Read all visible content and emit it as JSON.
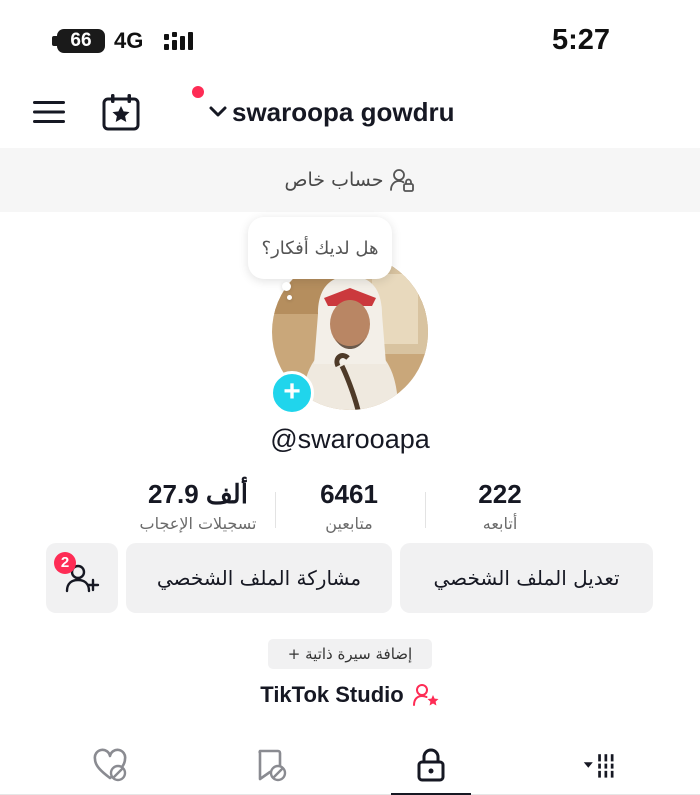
{
  "status_bar": {
    "battery": "66",
    "network": "4G",
    "time": "5:27"
  },
  "header": {
    "username": "swaroopa gowdru",
    "menu_icon": "hamburger-menu-icon",
    "calendar_icon": "calendar-star-icon",
    "switch_icon": "chevron-down-icon"
  },
  "private_banner": {
    "label": "حساب خاص",
    "icon": "private-account-icon"
  },
  "profile": {
    "bubble_text": "هل لديك أفكار؟",
    "handle": "@swarooapa"
  },
  "stats": [
    {
      "value": "222",
      "label": "أتابعه"
    },
    {
      "value": "6461",
      "label": "متابعين"
    },
    {
      "value": "27.9 ألف",
      "label": "تسجيلات الإعجاب"
    }
  ],
  "actions": {
    "edit_profile": "تعديل الملف الشخصي",
    "share_profile": "مشاركة الملف الشخصي",
    "friend_requests_count": "2"
  },
  "bio_button": "+ إضافة سيرة ذاتية",
  "studio": {
    "label": "TikTok Studio"
  },
  "tabs": [
    {
      "icon": "grid-videos-icon",
      "active": false
    },
    {
      "icon": "private-lock-icon",
      "active": true
    },
    {
      "icon": "favorites-bookmark-icon",
      "active": false
    },
    {
      "icon": "liked-heart-icon",
      "active": false
    }
  ],
  "colors": {
    "accent": "#fe2c55",
    "add_avatar": "#20d5ec",
    "text": "#161823",
    "muted": "#6b6b6b"
  }
}
